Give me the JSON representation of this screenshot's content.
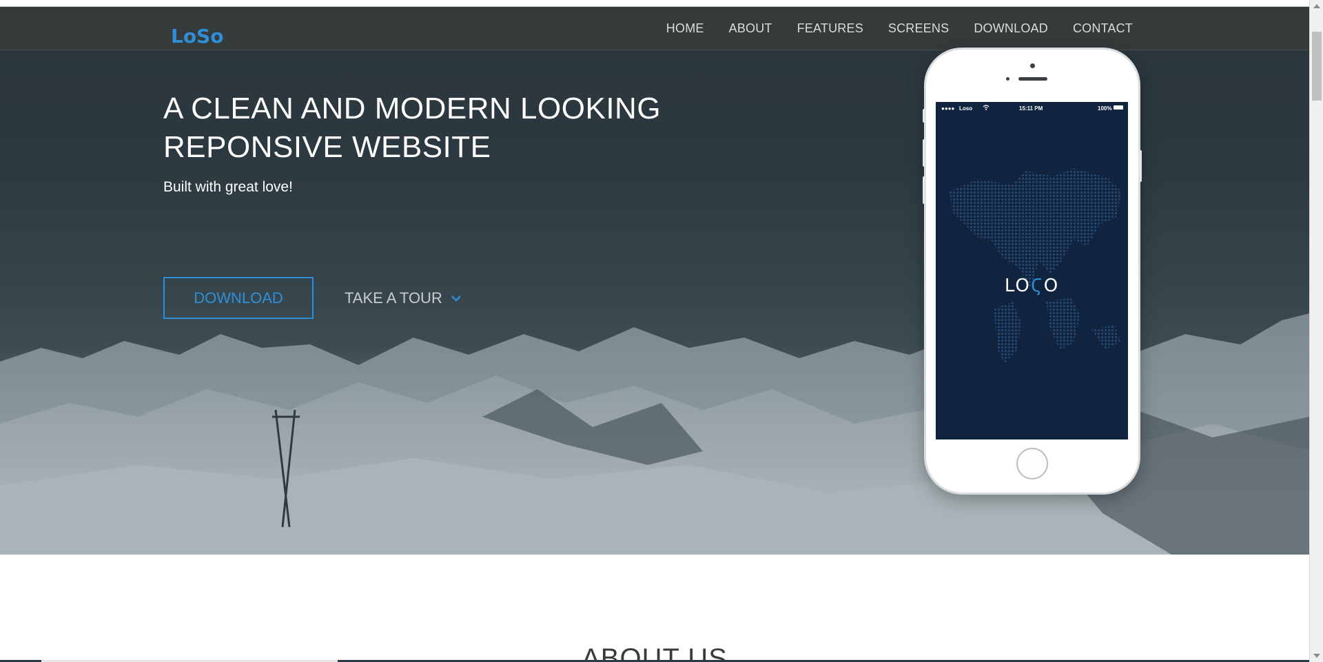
{
  "brand": {
    "logo_text": "LoSo",
    "accent_color": "#2f8ed8"
  },
  "nav": {
    "items": [
      {
        "label": "HOME"
      },
      {
        "label": "ABOUT"
      },
      {
        "label": "FEATURES"
      },
      {
        "label": "SCREENS"
      },
      {
        "label": "DOWNLOAD"
      },
      {
        "label": "CONTACT"
      }
    ]
  },
  "hero": {
    "title_line1": "A CLEAN AND MODERN LOOKING",
    "title_line2": "REPONSIVE WEBSITE",
    "subtitle": "Built with great love!",
    "download_label": "DOWNLOAD",
    "tour_label": "TAKE A TOUR",
    "tour_icon": "chevron-down-icon"
  },
  "phone": {
    "status": {
      "signal": "●●●●",
      "carrier": "Loso",
      "time": "15:11 PM",
      "battery": "100%"
    },
    "app_logo_left": "LO",
    "app_logo_accent": "Ϛ",
    "app_logo_right": "O",
    "screen_color": "#102440"
  },
  "about": {
    "title": "ABOUT US"
  }
}
